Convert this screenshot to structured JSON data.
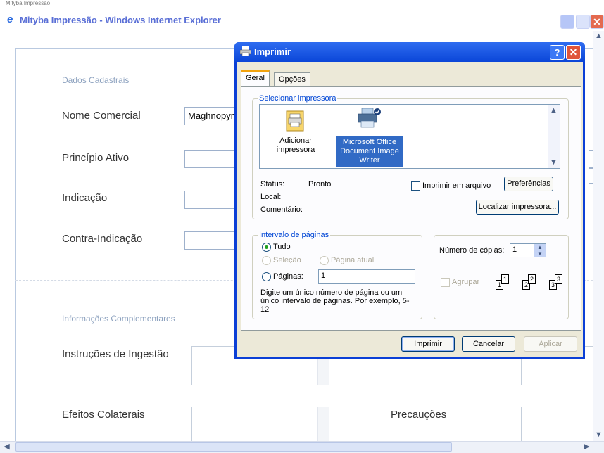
{
  "window": {
    "title": "Mityba Impressão - Windows Internet Explorer",
    "top_text": "Mityba Impressão"
  },
  "form": {
    "section1_title": "Dados Cadastrais",
    "nome_comercial_label": "Nome Comercial",
    "nome_comercial_value": "Maghnopyr",
    "principio_ativo_label": "Princípio Ativo",
    "indicacao_label": "Indicação",
    "contra_indicacao_label": "Contra-Indicação",
    "section2_title": "Informações Complementares",
    "instrucoes_label": "Instruções de Ingestão",
    "efeitos_label": "Efeitos Colaterais",
    "precaucoes_label": "Precauções"
  },
  "dialog": {
    "title": "Imprimir",
    "tabs": [
      {
        "label": "Geral"
      },
      {
        "label": "Opções"
      }
    ],
    "select_printer_legend": "Selecionar impressora",
    "printers": [
      {
        "name": "Adicionar impressora"
      },
      {
        "name": "Microsoft Office Document Image Writer"
      }
    ],
    "status_label": "Status:",
    "status_value": "Pronto",
    "local_label": "Local:",
    "comentario_label": "Comentário:",
    "print_to_file_label": "Imprimir em arquivo",
    "preferences_button": "Preferências",
    "find_printer_button": "Localizar impressora...",
    "page_range_legend": "Intervalo de páginas",
    "all_label": "Tudo",
    "selection_label": "Seleção",
    "current_page_label": "Página atual",
    "pages_label": "Páginas:",
    "pages_value": "1",
    "page_range_hint": "Digite um único número de página ou um único intervalo de páginas. Por exemplo, 5-12",
    "copies_label": "Número de cópias:",
    "copies_value": "1",
    "collate_label": "Agrupar",
    "print_button": "Imprimir",
    "cancel_button": "Cancelar",
    "apply_button": "Aplicar"
  }
}
